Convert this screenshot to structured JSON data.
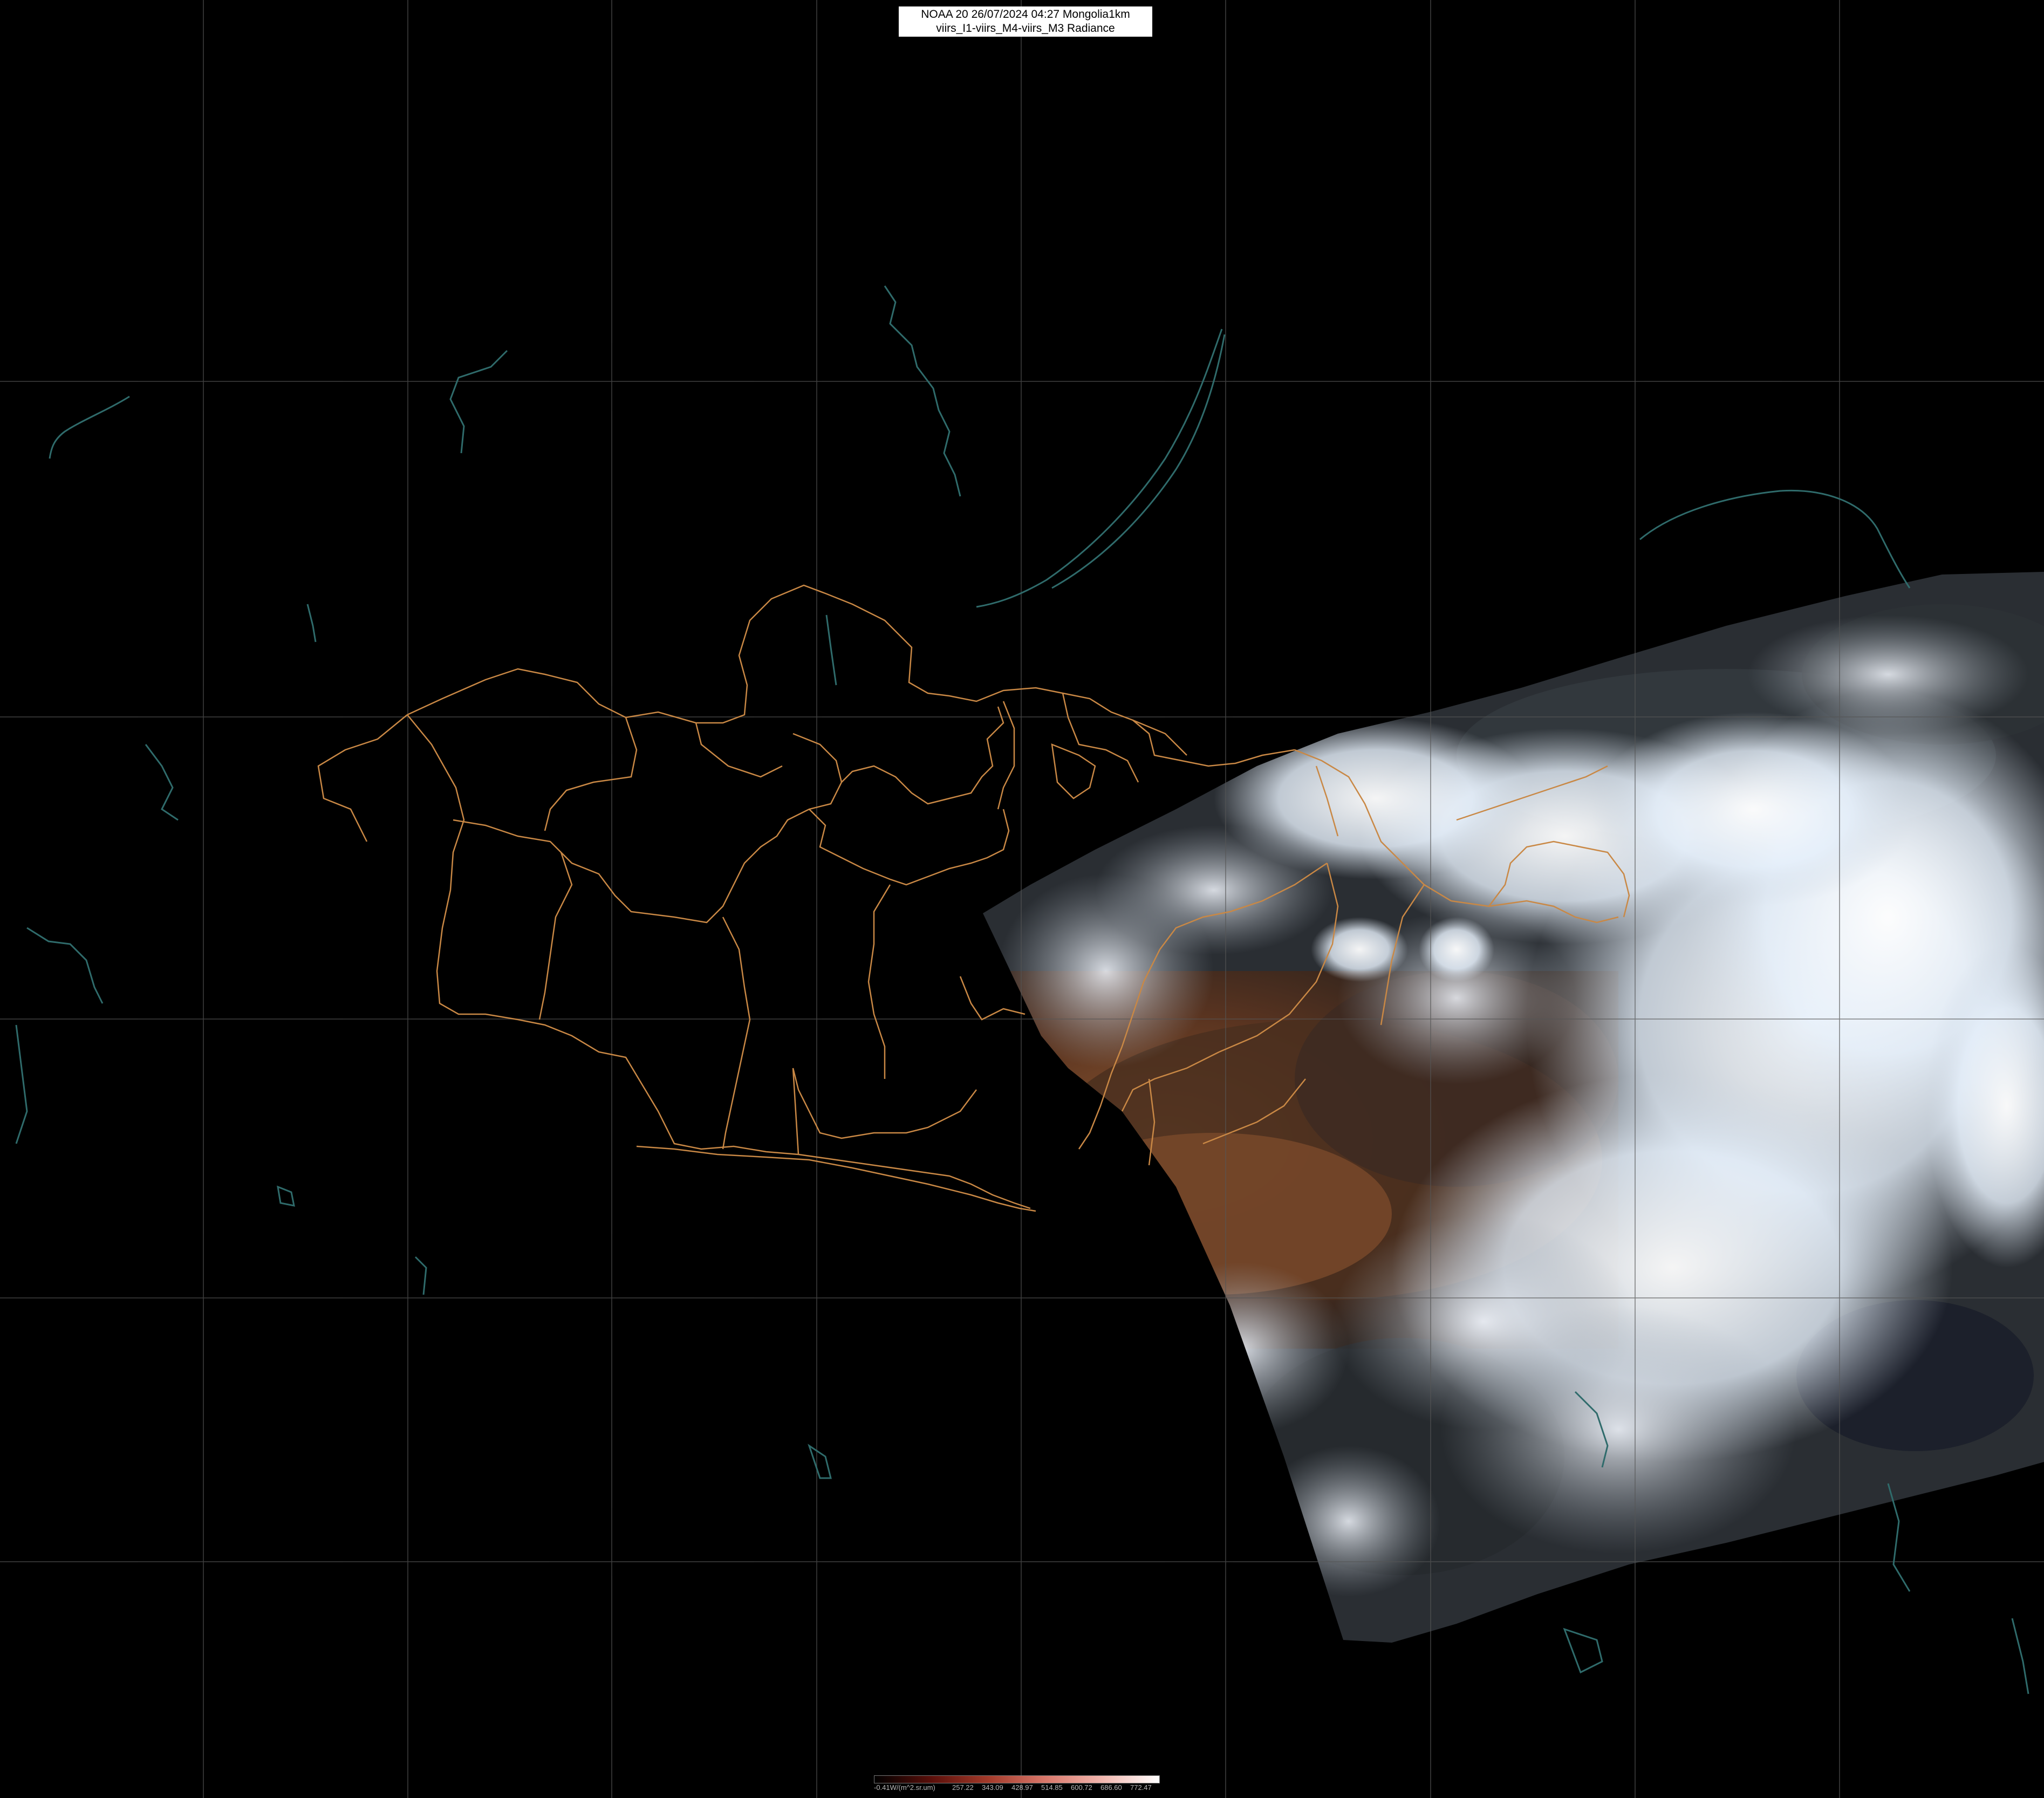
{
  "header": {
    "title_line1": "NOAA 20 26/07/2024 04:27 Mongolia1km",
    "title_line2": "viirs_I1-viirs_M4-viirs_M3 Radiance"
  },
  "legend": {
    "unit_label": "-0.41W/(m^2.sr.um)",
    "ticks": [
      "257.22",
      "343.09",
      "428.97",
      "514.85",
      "600.72",
      "686.60",
      "772.47"
    ],
    "colors": [
      "#000000",
      "#5a0f0a",
      "#a33a2a",
      "#d9776a",
      "#f2b6ae",
      "#ffffff"
    ]
  },
  "colors": {
    "background": "#000000",
    "grid": "#555555",
    "admin_borders": "#c98845",
    "water_features": "#2f6b6b",
    "cloud": "#e9f3ff",
    "land_brown": "#6a3d22"
  },
  "layers": [
    "graticule",
    "satellite-swath",
    "admin-borders",
    "lakes-and-rivers"
  ]
}
